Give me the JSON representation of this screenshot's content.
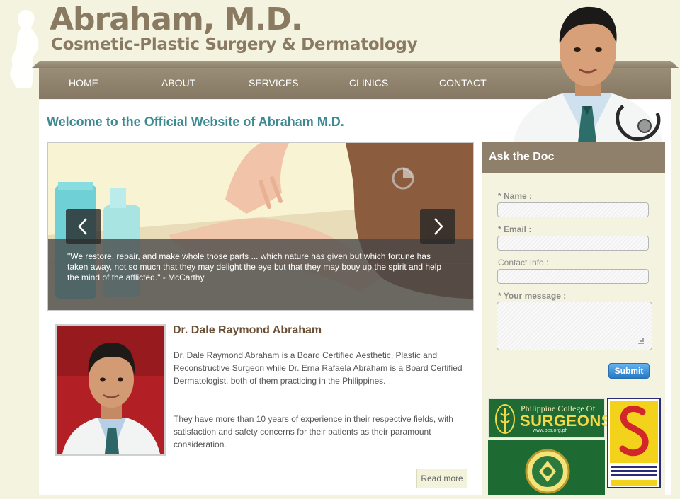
{
  "brand": {
    "title": "Abraham, M.D.",
    "subtitle": "Cosmetic-Plastic Surgery & Dermatology"
  },
  "nav": {
    "items": [
      {
        "label": "HOME"
      },
      {
        "label": "ABOUT"
      },
      {
        "label": "SERVICES"
      },
      {
        "label": "CLINICS"
      },
      {
        "label": "CONTACT"
      }
    ]
  },
  "main": {
    "welcome": "Welcome to the Official Website of Abraham M.D.",
    "slider": {
      "quote": "\"We restore, repair, and make whole those parts ... which nature has given but which fortune has taken away, not so much that they may delight the eye but that they may bouy up the spirit and help the mind of the afflicted.\" -  McCarthy"
    },
    "bio": {
      "name": "Dr. Dale Raymond Abraham",
      "paragraph1": "Dr. Dale Raymond Abraham is a Board Certified Aesthetic, Plastic and Reconstructive Surgeon while Dr. Erna Rafaela Abraham is a Board Certified Dermatologist, both of them practicing in the Philippines.",
      "paragraph2": "They have more than 10 years of experience in their respective fields, with satisfaction and safety concerns for their patients as their paramount consideration.",
      "read_more": "Read more"
    }
  },
  "sidebar": {
    "title": "Ask the Doc",
    "form": {
      "name_label": "* Name :",
      "name_value": "",
      "email_label": "* Email :",
      "email_value": "",
      "contact_label": "Contact Info :",
      "contact_value": "",
      "message_label": "* Your message :",
      "message_value": "",
      "submit_label": "Submit"
    },
    "logos": {
      "pcs_line1": "Philippine College Of",
      "pcs_line2": "SURGEONS",
      "pcs_line3": "www.pcs.org.ph"
    }
  },
  "colors": {
    "nav_bg": "#8e806b",
    "brand_text": "#8a7a62",
    "welcome_text": "#3d8a93",
    "submit_blue": "#2f86d2"
  }
}
